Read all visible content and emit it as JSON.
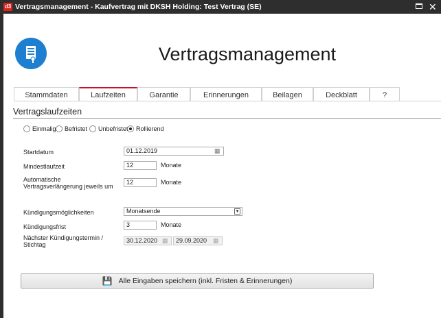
{
  "window": {
    "logo_text": "d3",
    "title": "Vertragsmanagement - Kaufvertrag mit DKSH Holding: Test Vertrag (SE)",
    "close_glyph": "✕"
  },
  "app": {
    "title": "Vertragsmanagement",
    "icon": "document-icon",
    "icon_color": "#1e7fd0"
  },
  "tabs": [
    {
      "label": "Stammdaten",
      "active": false
    },
    {
      "label": "Laufzeiten",
      "active": true
    },
    {
      "label": "Garantie",
      "active": false
    },
    {
      "label": "Erinnerungen",
      "active": false
    },
    {
      "label": "Beilagen",
      "active": false
    },
    {
      "label": "Deckblatt",
      "active": false
    },
    {
      "label": "?",
      "active": false
    }
  ],
  "accent_color": "#c8102e",
  "section": {
    "title": "Vertragslaufzeiten"
  },
  "radios": [
    {
      "label": "Einmalig",
      "checked": false
    },
    {
      "label": "Befristet",
      "checked": false
    },
    {
      "label": "Unbefristet",
      "checked": false
    },
    {
      "label": "Rollierend",
      "checked": true
    }
  ],
  "fields": {
    "startdatum": {
      "label": "Startdatum",
      "value": "01.12.2019"
    },
    "mindestlaufzeit": {
      "label": "Mindestlaufzeit",
      "value": "12",
      "unit": "Monate"
    },
    "verlaengerung": {
      "label": "Automatische Vertragsverlängerung jeweils um",
      "value": "12",
      "unit": "Monate"
    },
    "kuendigungsmoeglichkeiten": {
      "label": "Kündigungsmöglichkeiten",
      "value": "Monatsende"
    },
    "kuendigungsfrist": {
      "label": "Kündigungsfrist",
      "value": "3",
      "unit": "Monate"
    },
    "naechster_termin": {
      "label": "Nächster Kündigungstermin / Stichtag",
      "value1": "30.12.2020",
      "value2": "29.09.2020"
    }
  },
  "save_button": {
    "label": "Alle Eingaben speichern (inkl. Fristen & Erinnerungen)",
    "icon": "floppy-disk-icon"
  }
}
